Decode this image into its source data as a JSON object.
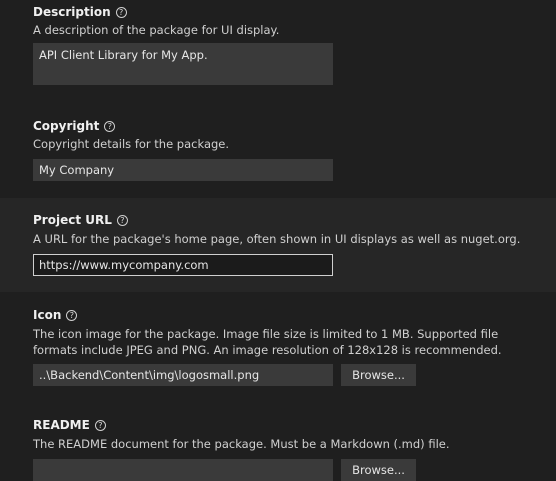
{
  "description": {
    "title": "Description",
    "help_icon": "?",
    "desc": "A description of the package for UI display.",
    "value": "API Client Library for My App."
  },
  "copyright": {
    "title": "Copyright",
    "help_icon": "?",
    "desc": "Copyright details for the package.",
    "value": "My Company"
  },
  "project_url": {
    "title": "Project URL",
    "help_icon": "?",
    "desc": "A URL for the package's home page, often shown in UI displays as well as nuget.org.",
    "value": "https://www.mycompany.com"
  },
  "icon": {
    "title": "Icon",
    "help_icon": "?",
    "desc": "The icon image for the package. Image file size is limited to 1 MB. Supported file formats include JPEG and PNG. An image resolution of 128x128 is recommended.",
    "value": "..\\Backend\\Content\\img\\logosmall.png",
    "browse_label": "Browse..."
  },
  "readme": {
    "title": "README",
    "help_icon": "?",
    "desc": "The README document for the package. Must be a Markdown (.md) file.",
    "value": "",
    "browse_label": "Browse..."
  }
}
